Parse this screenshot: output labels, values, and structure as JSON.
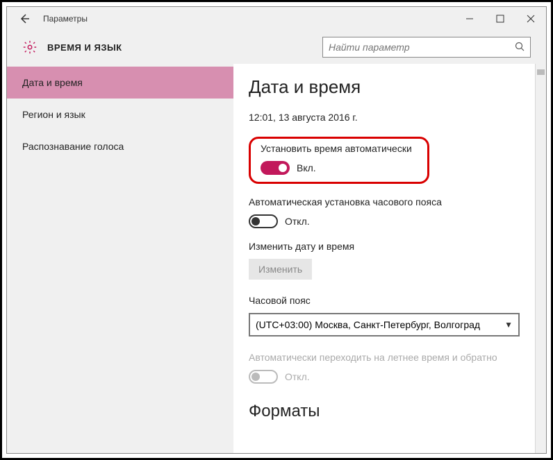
{
  "titlebar": {
    "title": "Параметры"
  },
  "header": {
    "title": "ВРЕМЯ И ЯЗЫК"
  },
  "search": {
    "placeholder": "Найти параметр"
  },
  "sidebar": {
    "items": [
      {
        "label": "Дата и время",
        "active": true
      },
      {
        "label": "Регион и язык",
        "active": false
      },
      {
        "label": "Распознавание голоса",
        "active": false
      }
    ]
  },
  "content": {
    "page_title": "Дата и время",
    "datetime": "12:01, 13 августа 2016 г.",
    "auto_time": {
      "label": "Установить время автоматически",
      "state": "Вкл."
    },
    "auto_tz": {
      "label": "Автоматическая установка часового пояса",
      "state": "Откл."
    },
    "change": {
      "label": "Изменить дату и время",
      "button": "Изменить"
    },
    "tz": {
      "label": "Часовой пояс",
      "value": "(UTC+03:00) Москва, Санкт-Петербург, Волгоград"
    },
    "dst": {
      "label": "Автоматически переходить на летнее время и обратно",
      "state": "Откл."
    },
    "formats_title": "Форматы"
  },
  "colors": {
    "accent": "#c2185b",
    "highlight": "#d90000",
    "sidebar_active": "#d78fb0"
  }
}
